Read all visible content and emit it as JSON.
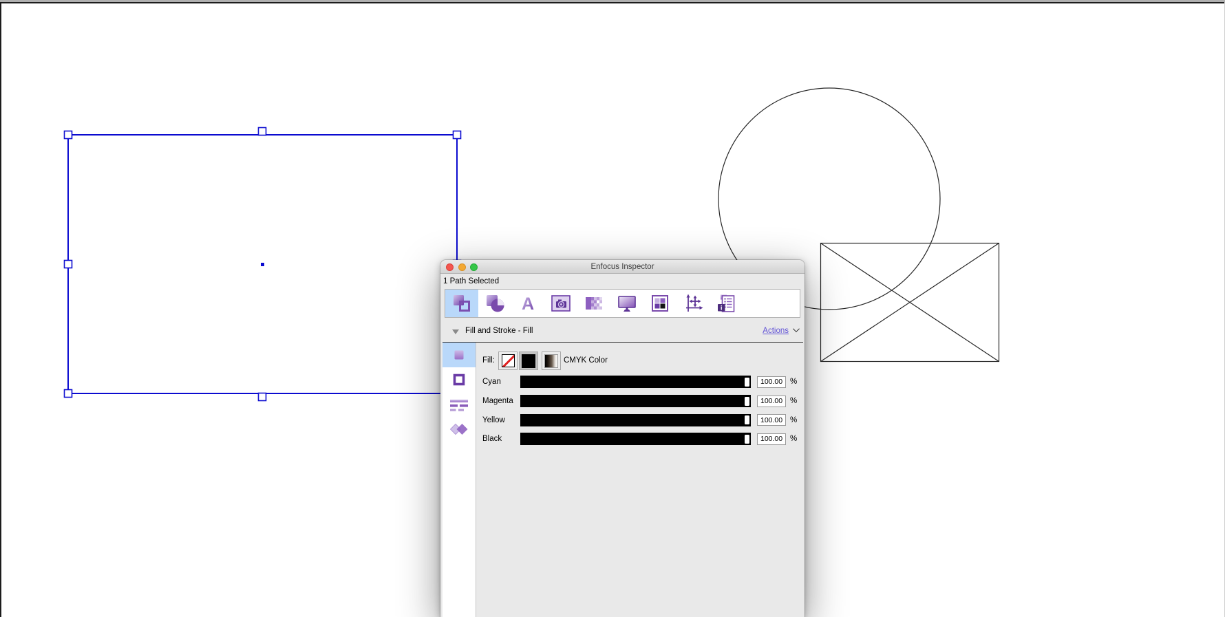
{
  "canvas": {
    "shapes": [
      {
        "type": "rectangle",
        "state": "selected",
        "stroke": "#0b0bd0",
        "handles": 8
      },
      {
        "type": "circle",
        "stroke": "#262626"
      },
      {
        "type": "placeholder-rectangle-x",
        "stroke": "#262626"
      }
    ]
  },
  "window": {
    "title": "Enfocus Inspector",
    "status_text": "1 Path Selected",
    "toolbar": {
      "tabs": [
        {
          "name": "fill-and-stroke",
          "selected": true
        },
        {
          "name": "line-art",
          "selected": false
        },
        {
          "name": "text",
          "selected": false
        },
        {
          "name": "image",
          "selected": false
        },
        {
          "name": "shading",
          "selected": false
        },
        {
          "name": "prepress",
          "selected": false
        },
        {
          "name": "separations",
          "selected": false
        },
        {
          "name": "position",
          "selected": false
        },
        {
          "name": "summary",
          "selected": false
        }
      ],
      "text_icon_glyph": "A",
      "summary_icon_glyph": "i"
    },
    "section": {
      "title": "Fill and Stroke - Fill",
      "actions_label": "Actions"
    },
    "sidebar_items": [
      {
        "name": "fill",
        "selected": true
      },
      {
        "name": "stroke",
        "selected": false
      },
      {
        "name": "dash",
        "selected": false
      },
      {
        "name": "overprint",
        "selected": false
      }
    ],
    "fill": {
      "label": "Fill:",
      "swatches": [
        {
          "name": "no-fill",
          "selected": false
        },
        {
          "name": "solid-black",
          "selected": true
        },
        {
          "name": "gradient",
          "selected": false
        }
      ],
      "color_space": "CMYK Color"
    },
    "channels": [
      {
        "label": "Cyan",
        "value": "100.00",
        "unit": "%",
        "percent": 100
      },
      {
        "label": "Magenta",
        "value": "100.00",
        "unit": "%",
        "percent": 100
      },
      {
        "label": "Yellow",
        "value": "100.00",
        "unit": "%",
        "percent": 100
      },
      {
        "label": "Black",
        "value": "100.00",
        "unit": "%",
        "percent": 100
      }
    ],
    "colors": {
      "selection_highlight": "#b9d8fa",
      "accent_purple": "#6a3ba6",
      "link": "#6254d6",
      "selection_blue": "#0b0bd0"
    }
  }
}
